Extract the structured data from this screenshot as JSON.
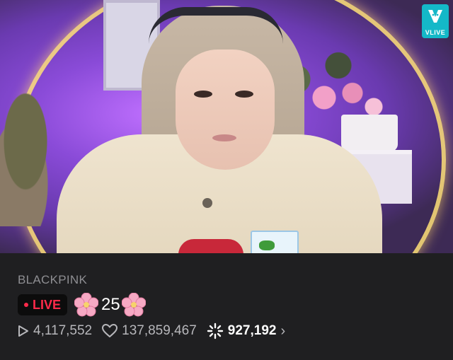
{
  "player": {
    "logo_text": "VLIVE",
    "icons": {
      "logo": "vlive-logo-icon"
    }
  },
  "info": {
    "channel": "BLACKPINK",
    "live_badge": "LIVE",
    "title_number": "25",
    "title_decorations": [
      "cherry-blossom-icon",
      "cherry-blossom-icon"
    ],
    "stats": {
      "plays": "4,117,552",
      "hearts": "137,859,467",
      "viewers": "927,192"
    },
    "icons": {
      "plays": "play-icon",
      "hearts": "heart-icon",
      "viewers": "sparkle-icon",
      "more": "chevron-right-icon"
    },
    "colors": {
      "live_red": "#ff2a4a",
      "background": "#1f1f21",
      "logo": "#14b8c8"
    }
  }
}
